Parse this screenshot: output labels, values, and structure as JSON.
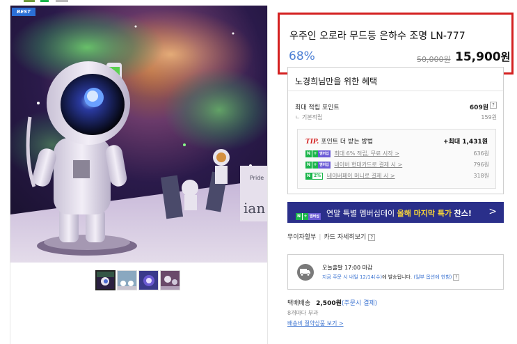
{
  "colors": {
    "accent_red": "#d42020",
    "discount_blue": "#4c7fd4",
    "banner_bg": "#2a2f8a",
    "naver_green": "#1ab54a",
    "link_blue": "#3a72d0"
  },
  "gallery": {
    "badge": "BEST",
    "thumbnail_count": 4,
    "active_thumbnail": 1,
    "watermark_text": "ian",
    "box_text": "Pride"
  },
  "product": {
    "title": "우주인 오로라 무드등 은하수 조명 LN-777",
    "discount": "68%",
    "original_price": "50,000원",
    "sale_price": "15,900",
    "sale_unit": "원"
  },
  "benefit": {
    "title": "노경희님만을 위한 혜택",
    "max_points_label": "최대 적립 포인트",
    "max_points_value": "609원",
    "help_icon": "?",
    "base_points_label": "ㄴ 기본적립",
    "base_points_value": "159원",
    "tip": {
      "mark": "TIP.",
      "heading": "포인트 더 받는 방법",
      "max": "+최대 1,431원",
      "rows": [
        {
          "badge": "N+멤버십",
          "text": "최대 6% 적립, 무료 시작 >",
          "value": "636원"
        },
        {
          "badge": "N+멤버십",
          "text": "네이버 현대카드로 결제 시 >",
          "value": "796원"
        },
        {
          "badge": "N 2%",
          "text": "네이버페이 머니로 결제 시 >",
          "value": "318원"
        }
      ]
    }
  },
  "banner": {
    "badge": "N+ 멤버십",
    "text_prefix": "연말 특별 멤버십데이",
    "text_highlight": "올해 마지막 특가",
    "text_suffix": "찬스!",
    "arrow": ">"
  },
  "installment": {
    "label": "무이자할부",
    "card_link": "카드 자세히보기",
    "help_icon": "?"
  },
  "delivery": {
    "title": "오늘출발 17:00 마감",
    "sub_blue": "지금 주문 시 내일 12/14(수)",
    "sub_rest": "에 발송됩니다.",
    "note": "(일부 옵션에 한함)",
    "help_icon": "?"
  },
  "shipping": {
    "label": "택배배송",
    "amount": "2,500원",
    "condition": "(주문시 결제)",
    "note": "8개마다 부과",
    "link": "배송비 절약상품 보기 >"
  }
}
